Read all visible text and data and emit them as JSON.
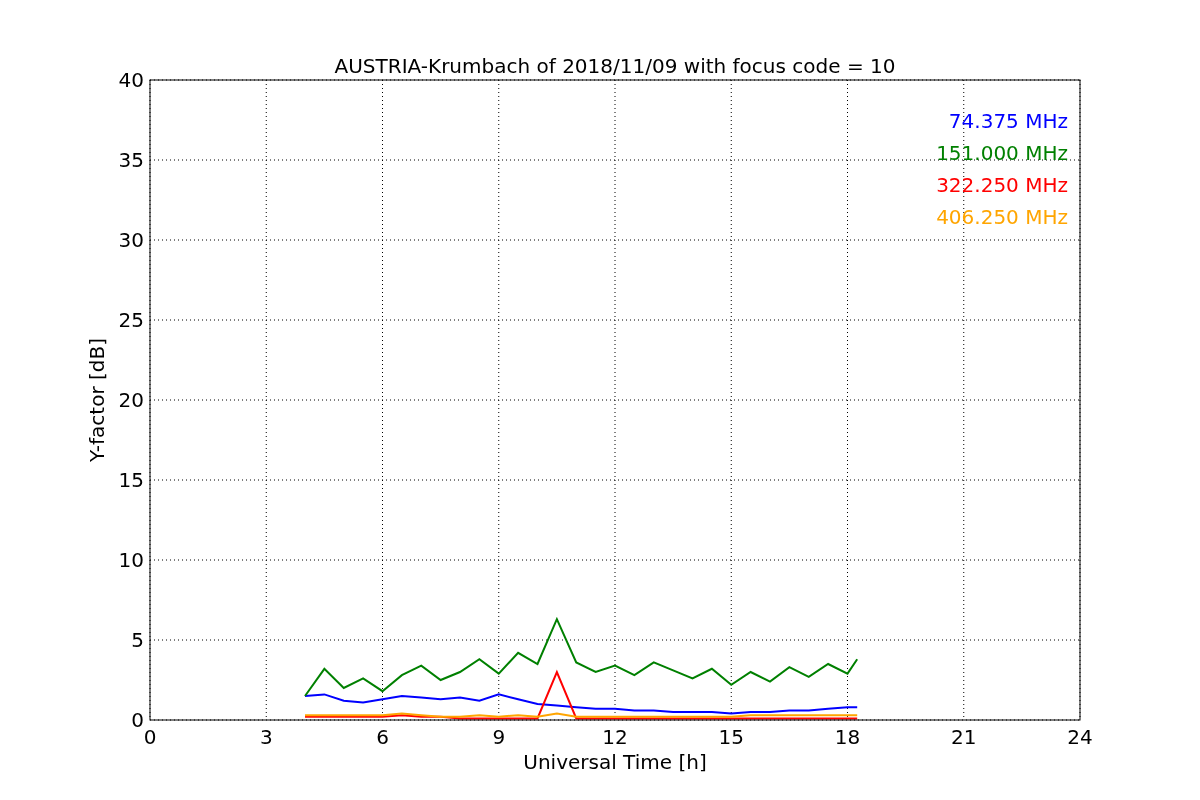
{
  "chart_data": {
    "type": "line",
    "title": "AUSTRIA-Krumbach of 2018/11/09 with focus code = 10",
    "xlabel": "Universal Time [h]",
    "ylabel": "Y-factor [dB]",
    "x": [
      4,
      4.5,
      5,
      5.5,
      6,
      6.5,
      7,
      7.5,
      8,
      8.5,
      9,
      9.5,
      10,
      10.5,
      11,
      11.5,
      12,
      12.5,
      13,
      13.5,
      14,
      14.5,
      15,
      15.5,
      16,
      16.5,
      17,
      17.5,
      18,
      18.25
    ],
    "grid": true,
    "xlim": [
      0,
      24
    ],
    "ylim": [
      0,
      40
    ],
    "xticks": [
      0,
      3,
      6,
      9,
      12,
      15,
      18,
      21,
      24
    ],
    "yticks": [
      0,
      5,
      10,
      15,
      20,
      25,
      30,
      35,
      40
    ],
    "series": [
      {
        "name": "74.375 MHz",
        "color": "#0000ff",
        "values": [
          1.5,
          1.6,
          1.2,
          1.1,
          1.3,
          1.5,
          1.4,
          1.3,
          1.4,
          1.2,
          1.6,
          1.3,
          1.0,
          0.9,
          0.8,
          0.7,
          0.7,
          0.6,
          0.6,
          0.5,
          0.5,
          0.5,
          0.4,
          0.5,
          0.5,
          0.6,
          0.6,
          0.7,
          0.8,
          0.8
        ]
      },
      {
        "name": "151.000 MHz",
        "color": "#008000",
        "values": [
          1.5,
          3.2,
          2.0,
          2.6,
          1.8,
          2.8,
          3.4,
          2.5,
          3.0,
          3.8,
          2.9,
          4.2,
          3.5,
          6.3,
          3.6,
          3.0,
          3.4,
          2.8,
          3.6,
          3.1,
          2.6,
          3.2,
          2.2,
          3.0,
          2.4,
          3.3,
          2.7,
          3.5,
          2.9,
          3.8
        ]
      },
      {
        "name": "322.250 MHz",
        "color": "#ff0000",
        "values": [
          0.2,
          0.2,
          0.2,
          0.2,
          0.2,
          0.3,
          0.2,
          0.2,
          0.1,
          0.1,
          0.1,
          0.1,
          0.1,
          3.0,
          0.1,
          0.1,
          0.1,
          0.1,
          0.1,
          0.1,
          0.1,
          0.1,
          0.1,
          0.1,
          0.1,
          0.1,
          0.1,
          0.1,
          0.1,
          0.1
        ]
      },
      {
        "name": "406.250 MHz",
        "color": "#ffa500",
        "values": [
          0.3,
          0.3,
          0.3,
          0.3,
          0.3,
          0.4,
          0.3,
          0.2,
          0.2,
          0.3,
          0.2,
          0.3,
          0.2,
          0.4,
          0.2,
          0.2,
          0.2,
          0.2,
          0.2,
          0.2,
          0.2,
          0.2,
          0.2,
          0.3,
          0.3,
          0.3,
          0.3,
          0.3,
          0.3,
          0.3
        ]
      }
    ]
  }
}
